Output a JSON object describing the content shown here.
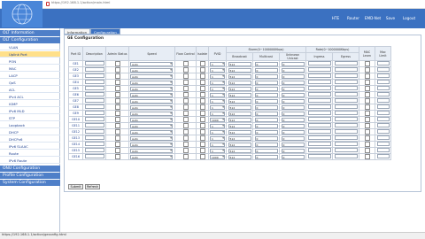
{
  "browser": {
    "url": "https://192.168.1.1/action/main.html"
  },
  "header": {
    "nav": [
      "HTE",
      "Router",
      "EMD-Net",
      "Save",
      "Logout"
    ]
  },
  "sidebar": {
    "sections": [
      {
        "label": "OLT Information"
      },
      {
        "label": "OLT Configuration"
      }
    ],
    "items": [
      "VLAN",
      "Uplink Port",
      "PON",
      "MAC",
      "LACP",
      "QoS",
      "ACL",
      "IPv4 ACL",
      "IGMP",
      "IPv6 MLD",
      "STP",
      "Loopback",
      "DHCP",
      "DHCPv6",
      "IPv6 SLAAC",
      "Route",
      "IPv6 Route"
    ],
    "footer_sections": [
      "ONU Configuration",
      "Profile Configuration",
      "System Configuration"
    ]
  },
  "tabs": [
    "Information",
    "Configuration"
  ],
  "panel": {
    "title": "GE Configuration"
  },
  "table": {
    "group_headers": {
      "storm": "Storm(0~1000000Kbps)",
      "rate": "Rate(0~1000000Kbps)"
    },
    "headers": [
      "Port ID",
      "Description",
      "Admin Status",
      "Speed",
      "Flow Control",
      "Isolate",
      "PVID",
      "Broadcast",
      "Multicast",
      "Unknown Unicast",
      "Ingress",
      "Egress",
      "MAC Learn",
      "Mac Limit"
    ],
    "rows": [
      {
        "port": "GE1",
        "speed": "Auto",
        "pvid": "1",
        "bcast": "512",
        "mcast": "0",
        "uucast": "0"
      },
      {
        "port": "GE2",
        "speed": "Auto",
        "pvid": "1",
        "bcast": "512",
        "mcast": "0",
        "uucast": "0"
      },
      {
        "port": "GE3",
        "speed": "Auto",
        "pvid": "1",
        "bcast": "512",
        "mcast": "0",
        "uucast": "0"
      },
      {
        "port": "GE4",
        "speed": "Auto",
        "pvid": "1",
        "bcast": "512",
        "mcast": "0",
        "uucast": "0"
      },
      {
        "port": "GE5",
        "speed": "Auto",
        "pvid": "1",
        "bcast": "512",
        "mcast": "0",
        "uucast": "0"
      },
      {
        "port": "GE6",
        "speed": "Auto",
        "pvid": "1",
        "bcast": "512",
        "mcast": "0",
        "uucast": "0"
      },
      {
        "port": "GE7",
        "speed": "Auto",
        "pvid": "1",
        "bcast": "512",
        "mcast": "0",
        "uucast": "0"
      },
      {
        "port": "GE8",
        "speed": "Auto",
        "pvid": "1",
        "bcast": "512",
        "mcast": "0",
        "uucast": "0"
      },
      {
        "port": "GE9",
        "speed": "Auto",
        "pvid": "1",
        "bcast": "512",
        "mcast": "0",
        "uucast": "0"
      },
      {
        "port": "GE10",
        "speed": "Auto",
        "pvid": "1000",
        "bcast": "512",
        "mcast": "0",
        "uucast": "0"
      },
      {
        "port": "GE11",
        "speed": "Auto",
        "pvid": "1",
        "bcast": "512",
        "mcast": "0",
        "uucast": "0"
      },
      {
        "port": "GE12",
        "speed": "Auto",
        "pvid": "1",
        "bcast": "512",
        "mcast": "0",
        "uucast": "0"
      },
      {
        "port": "GE13",
        "speed": "Auto",
        "pvid": "1",
        "bcast": "512",
        "mcast": "0",
        "uucast": "0"
      },
      {
        "port": "GE14",
        "speed": "Auto",
        "pvid": "1",
        "bcast": "512",
        "mcast": "0",
        "uucast": "0"
      },
      {
        "port": "GE15",
        "speed": "Auto",
        "pvid": "1",
        "bcast": "512",
        "mcast": "0",
        "uucast": "0"
      },
      {
        "port": "GE16",
        "speed": "Auto",
        "pvid": "1000",
        "bcast": "512",
        "mcast": "0",
        "uucast": "0"
      }
    ]
  },
  "buttons": {
    "submit": "Submit",
    "refresh": "Refresh"
  },
  "status": {
    "text": "https://192.168.1.1/action/geconfig.html"
  },
  "colors": {
    "header": "#3b71c1",
    "sidebar_head": "#4f7fc8",
    "active_item": "#ffe08a"
  }
}
